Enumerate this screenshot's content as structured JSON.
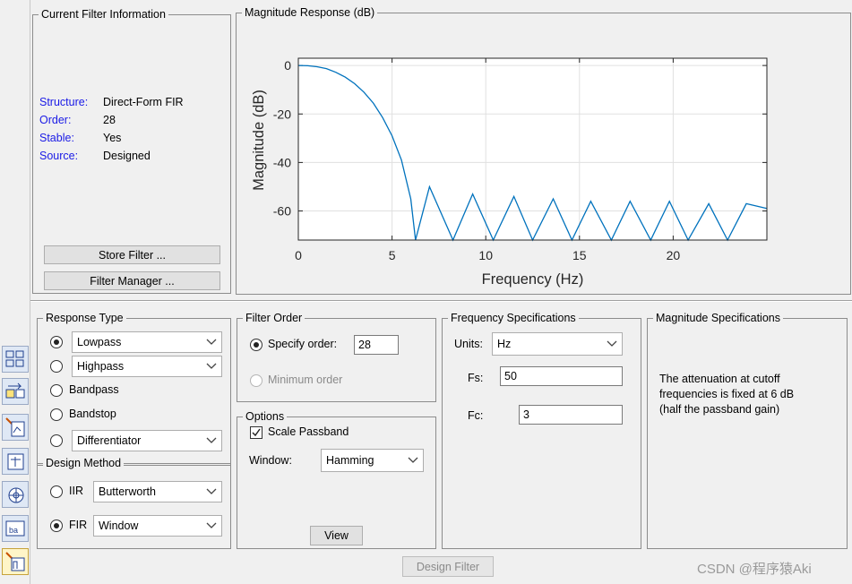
{
  "filter_info": {
    "title": "Current Filter Information",
    "rows": [
      {
        "label": "Structure:",
        "value": "Direct-Form FIR"
      },
      {
        "label": "Order:",
        "value": "28"
      },
      {
        "label": "Stable:",
        "value": "Yes"
      },
      {
        "label": "Source:",
        "value": "Designed"
      }
    ],
    "store_button": "Store Filter ...",
    "manager_button": "Filter Manager ..."
  },
  "plot": {
    "title": "Magnitude Response (dB)",
    "xlabel": "Frequency (Hz)",
    "ylabel": "Magnitude (dB)",
    "xticks": [
      "0",
      "5",
      "10",
      "15",
      "20"
    ],
    "yticks": [
      "0",
      "-20",
      "-40",
      "-60"
    ],
    "line_color": "#0072bd"
  },
  "chart_data": {
    "type": "line",
    "title": "Magnitude Response (dB)",
    "xlabel": "Frequency (Hz)",
    "ylabel": "Magnitude (dB)",
    "xlim": [
      0,
      25
    ],
    "ylim": [
      -72,
      3
    ],
    "grid": true,
    "series": [
      {
        "x": [
          0,
          0.5,
          1,
          1.5,
          2,
          2.5,
          3,
          3.5,
          4,
          4.5,
          5,
          5.5,
          6,
          6.25,
          7,
          8.25,
          9.3,
          10.4,
          11.5,
          12.5,
          13.6,
          14.6,
          15.6,
          16.7,
          17.7,
          18.8,
          19.8,
          20.8,
          21.9,
          22.9,
          23.9,
          25
        ],
        "y": [
          0,
          -0.1,
          -0.5,
          -1.3,
          -2.8,
          -4.8,
          -7.5,
          -11,
          -15.5,
          -21.5,
          -29,
          -39,
          -55,
          -72,
          -50,
          -72,
          -53,
          -72,
          -54,
          -72,
          -55,
          -72,
          -56,
          -72,
          -56,
          -72,
          -56,
          -72,
          -57,
          -72,
          -57,
          -59
        ]
      }
    ]
  },
  "response_type": {
    "title": "Response Type",
    "lowpass": "Lowpass",
    "highpass": "Highpass",
    "bandpass": "Bandpass",
    "bandstop": "Bandstop",
    "differentiator": "Differentiator"
  },
  "design_method": {
    "title": "Design Method",
    "iir_label": "IIR",
    "iir_value": "Butterworth",
    "fir_label": "FIR",
    "fir_value": "Window"
  },
  "filter_order": {
    "title": "Filter Order",
    "specify_label": "Specify order:",
    "specify_value": "28",
    "minimum_label": "Minimum order"
  },
  "options": {
    "title": "Options",
    "scale_label": "Scale Passband",
    "window_label": "Window:",
    "window_value": "Hamming",
    "view_button": "View"
  },
  "freq_spec": {
    "title": "Frequency Specifications",
    "units_label": "Units:",
    "units_value": "Hz",
    "fs_label": "Fs:",
    "fs_value": "50",
    "fc_label": "Fc:",
    "fc_value": "3"
  },
  "mag_spec": {
    "title": "Magnitude Specifications",
    "line1": "The attenuation at cutoff",
    "line2": "frequencies is fixed at 6 dB",
    "line3": "(half the passband gain)"
  },
  "design_button": "Design Filter",
  "watermark": "CSDN @程序猿Aki",
  "toolbar_icons": [
    "realize-model-icon",
    "transform-filter-icon",
    "pole-zero-editor-icon",
    "import-filter-icon",
    "design-filter-icon",
    "multirate-icon",
    "quantization-icon"
  ]
}
